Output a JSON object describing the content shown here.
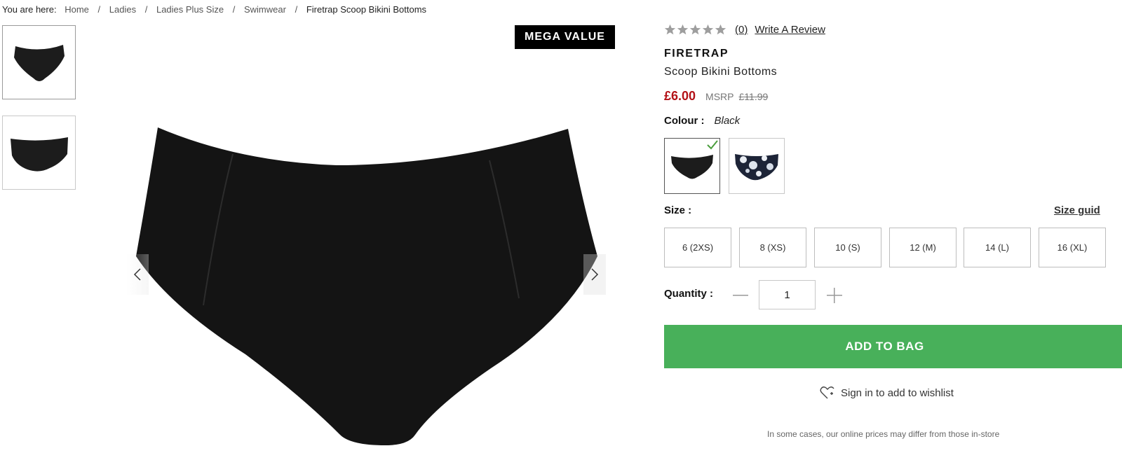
{
  "breadcrumb": {
    "lead": "You are here:",
    "items": [
      "Home",
      "Ladies",
      "Ladies Plus Size",
      "Swimwear",
      "Firetrap Scoop Bikini Bottoms"
    ],
    "separator": "/"
  },
  "gallery": {
    "badge": "MEGA VALUE",
    "thumbnails": [
      "front view",
      "back view"
    ]
  },
  "product": {
    "rating": {
      "stars": 0,
      "max_stars": 5,
      "count_label": "(0)",
      "write_review": "Write A Review"
    },
    "brand": "FIRETRAP",
    "name": "Scoop Bikini Bottoms",
    "price": "£6.00",
    "msrp_label": "MSRP",
    "msrp_value": "£11.99",
    "colour_label": "Colour :",
    "colour_value": "Black",
    "swatches": [
      {
        "name": "Black",
        "selected": true
      },
      {
        "name": "Floral print",
        "selected": false
      }
    ],
    "size_label": "Size :",
    "size_guide": "Size guid",
    "sizes": [
      "6 (2XS)",
      "8 (XS)",
      "10 (S)",
      "12 (M)",
      "14 (L)",
      "16 (XL)"
    ],
    "quantity_label": "Quantity :",
    "quantity_value": "1",
    "add_to_bag": "ADD TO BAG",
    "wishlist": "Sign in to add to wishlist",
    "price_note": "In some cases, our online prices may differ from those in-store"
  },
  "colors": {
    "price_red": "#b31217",
    "add_green": "#48b05a",
    "badge_black": "#000000",
    "check_green": "#4a9d3c"
  }
}
